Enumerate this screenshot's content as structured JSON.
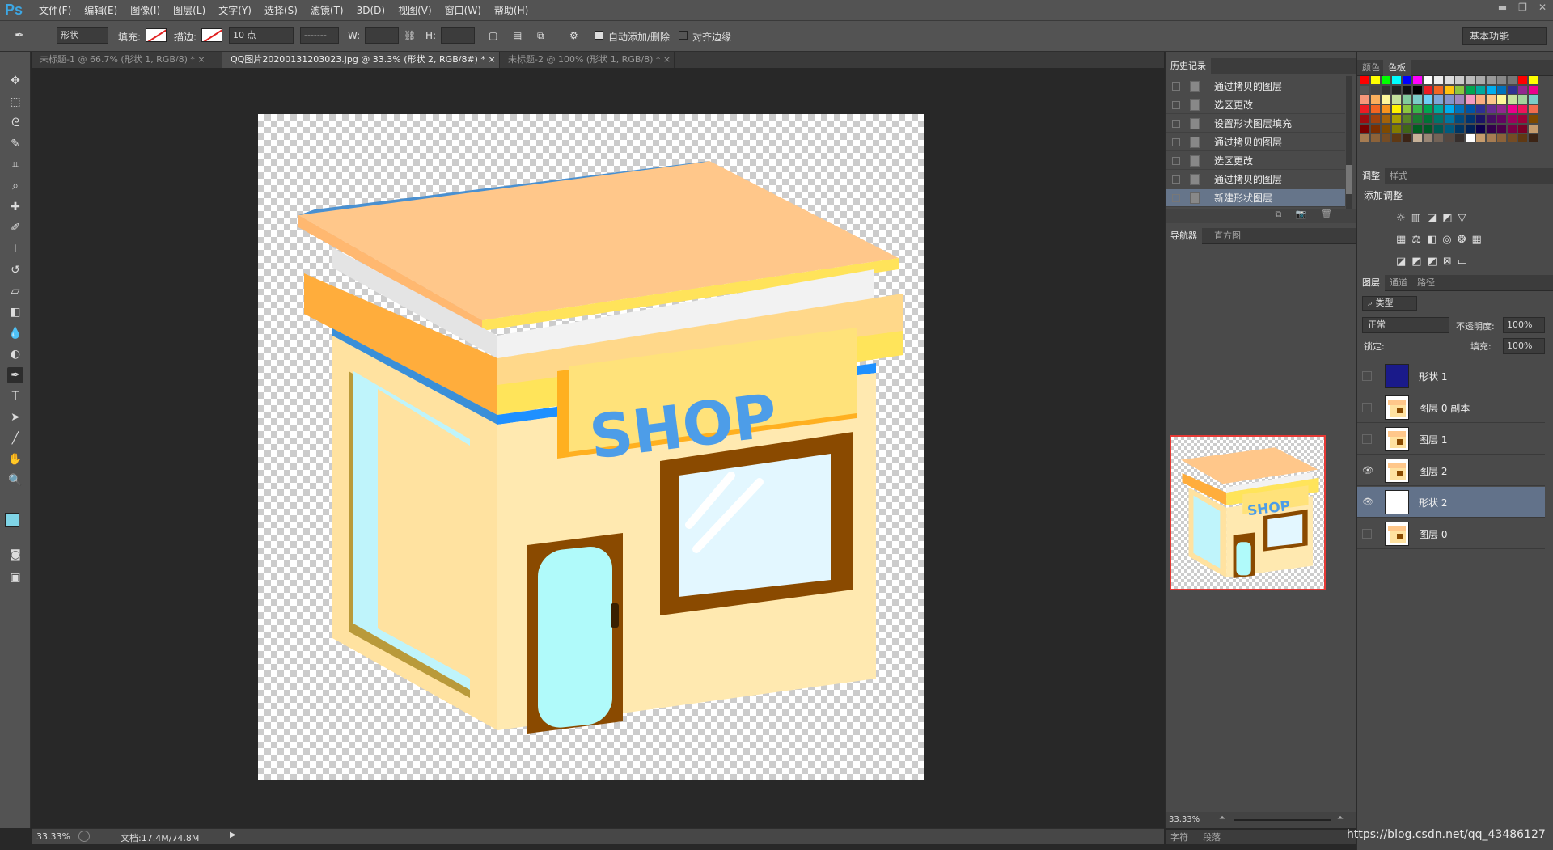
{
  "app": {
    "logo": "Ps"
  },
  "menu": [
    "文件(F)",
    "编辑(E)",
    "图像(I)",
    "图层(L)",
    "文字(Y)",
    "选择(S)",
    "滤镜(T)",
    "3D(D)",
    "视图(V)",
    "窗口(W)",
    "帮助(H)"
  ],
  "options": {
    "mode": "形状",
    "fill_label": "填充:",
    "stroke_label": "描边:",
    "stroke_size": "10 点",
    "w_label": "W:",
    "h_label": "H:",
    "auto_add_delete": "自动添加/删除",
    "align_edges": "对齐边缘",
    "workspace": "基本功能"
  },
  "tabs": [
    {
      "label": "未标题-1 @ 66.7% (形状 1, RGB/8) *",
      "active": false
    },
    {
      "label": "QQ图片20200131203023.jpg @ 33.3% (形状 2, RGB/8#) *",
      "active": true
    },
    {
      "label": "未标题-2 @ 100% (形状 1, RGB/8) *",
      "active": false
    }
  ],
  "artwork": {
    "sign_text": "SHOP"
  },
  "status": {
    "zoom": "33.33%",
    "doc_size": "文档:17.4M/74.8M"
  },
  "history": {
    "tab": "历史记录",
    "items": [
      {
        "label": "通过拷贝的图层",
        "selected": false
      },
      {
        "label": "选区更改",
        "selected": false
      },
      {
        "label": "设置形状图层填充",
        "selected": false
      },
      {
        "label": "通过拷贝的图层",
        "selected": false
      },
      {
        "label": "选区更改",
        "selected": false
      },
      {
        "label": "通过拷贝的图层",
        "selected": false
      },
      {
        "label": "新建形状图层",
        "selected": true
      }
    ]
  },
  "navigator": {
    "tabs": [
      "导航器",
      "直方图"
    ],
    "zoom": "33.33%",
    "bottom_tabs": [
      "字符",
      "段落"
    ]
  },
  "swatches_panel": {
    "tabs": [
      "颜色",
      "色板"
    ]
  },
  "adjustments": {
    "tabs": [
      "调整",
      "样式"
    ],
    "title": "添加调整"
  },
  "layers_panel": {
    "tabs": [
      "图层",
      "通道",
      "路径"
    ],
    "filter": "类型",
    "blend_mode": "正常",
    "opacity_label": "不透明度:",
    "opacity": "100%",
    "lock_label": "锁定:",
    "fill_label": "填充:",
    "fill": "100%",
    "layers": [
      {
        "name": "形状 1",
        "visible": false,
        "selected": false,
        "thumb": "shape-navy"
      },
      {
        "name": "图层 0 副本",
        "visible": false,
        "selected": false,
        "thumb": "shop"
      },
      {
        "name": "图层 1",
        "visible": false,
        "selected": false,
        "thumb": "shop"
      },
      {
        "name": "图层 2",
        "visible": true,
        "selected": false,
        "thumb": "shop"
      },
      {
        "name": "形状 2",
        "visible": true,
        "selected": true,
        "thumb": "shape-empty"
      },
      {
        "name": "图层 0",
        "visible": false,
        "selected": false,
        "thumb": "shop"
      }
    ]
  },
  "watermark": "https://blog.csdn.net/qq_43486127",
  "colors": {
    "accent": "#3da7e4",
    "selection": "#62728a",
    "nav_frame": "#e53935"
  }
}
